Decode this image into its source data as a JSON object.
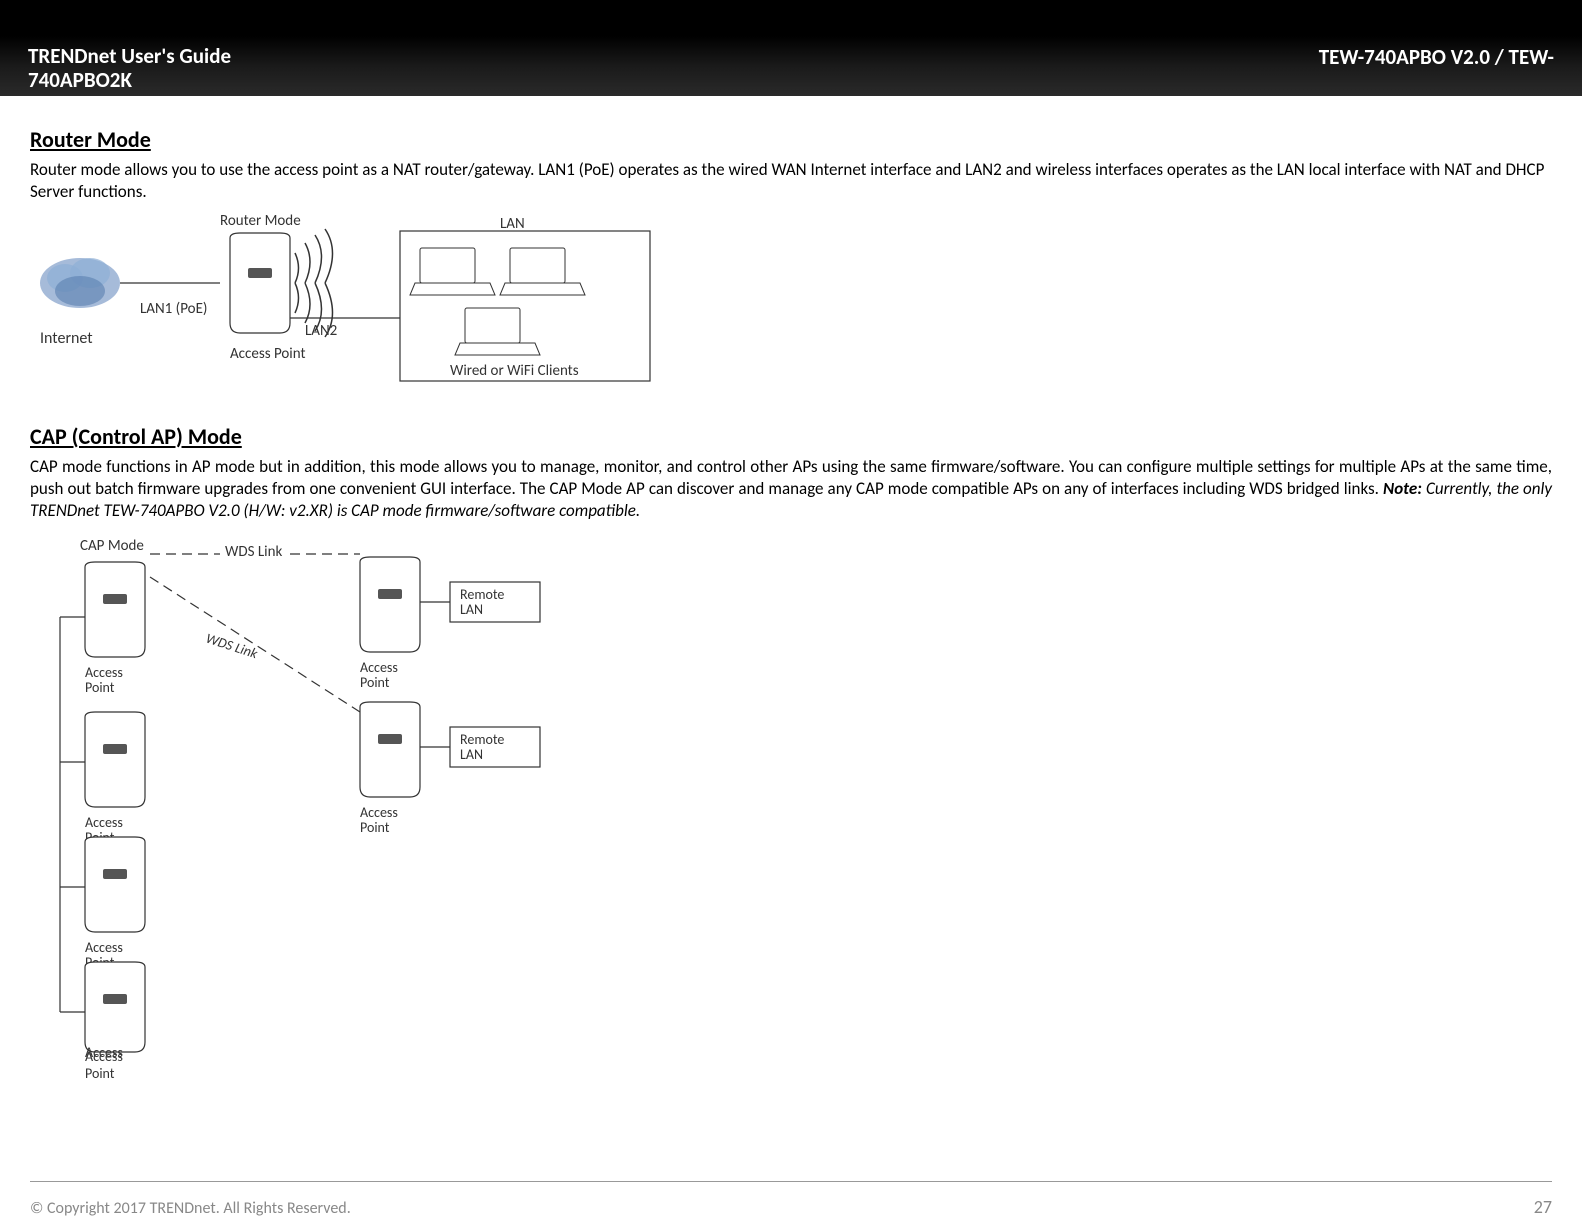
{
  "header": {
    "guide_line1": "TRENDnet User's Guide",
    "guide_line2": "740APBO2K",
    "model": "TEW-740APBO V2.0 / TEW-"
  },
  "sections": {
    "router_mode": {
      "title": "Router Mode",
      "body": "Router mode allows you to use the access point as a NAT router/gateway. LAN1 (PoE) operates as the wired WAN Internet interface and LAN2 and wireless interfaces operates as the LAN local interface with NAT and DHCP Server functions.",
      "diagram": {
        "title": "Router Mode",
        "internet_label": "Internet",
        "lan1_label": "LAN1 (PoE)",
        "ap_label": "Access Point",
        "lan2_label": "LAN2",
        "lan_label": "LAN",
        "clients_label": "Wired or WiFi Clients"
      }
    },
    "cap_mode": {
      "title": "CAP (Control AP) Mode",
      "body": "CAP mode functions in AP mode but in addition, this mode allows you to manage, monitor, and control other APs using the same firmware/software. You can configure multiple settings for multiple APs at the same time, push out batch firmware upgrades from one convenient GUI interface. The CAP Mode AP can discover and manage any CAP mode compatible APs on any of interfaces including WDS bridged links.",
      "note_label": "Note:",
      "note_text": " Currently, the only TRENDnet TEW-740APBO V2.0 (H/W: v2.XR) is CAP mode firmware/software compatible.",
      "diagram": {
        "cap_mode_label": "CAP Mode",
        "wds_link_label": "WDS Link",
        "wds_link_label2": "WDS Link",
        "ap_label": "Access Point",
        "remote_lan_label": "Remote LAN"
      }
    }
  },
  "footer": {
    "copyright": "© Copyright 2017 TRENDnet. All Rights Reserved.",
    "page": "27"
  }
}
